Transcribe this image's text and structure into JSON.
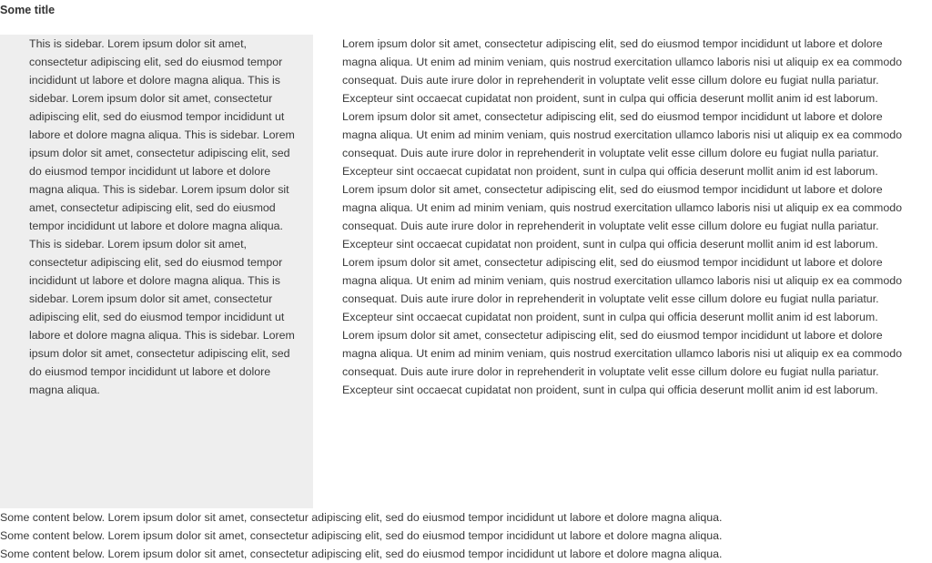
{
  "page": {
    "title": "Some title"
  },
  "sidebar": {
    "text": "This is sidebar. Lorem ipsum dolor sit amet, consectetur adipiscing elit, sed do eiusmod tempor incididunt ut labore et dolore magna aliqua. This is sidebar. Lorem ipsum dolor sit amet, consectetur adipiscing elit, sed do eiusmod tempor incididunt ut labore et dolore magna aliqua. This is sidebar. Lorem ipsum dolor sit amet, consectetur adipiscing elit, sed do eiusmod tempor incididunt ut labore et dolore magna aliqua. This is sidebar. Lorem ipsum dolor sit amet, consectetur adipiscing elit, sed do eiusmod tempor incididunt ut labore et dolore magna aliqua. This is sidebar. Lorem ipsum dolor sit amet, consectetur adipiscing elit, sed do eiusmod tempor incididunt ut labore et dolore magna aliqua. This is sidebar. Lorem ipsum dolor sit amet, consectetur adipiscing elit, sed do eiusmod tempor incididunt ut labore et dolore magna aliqua. This is sidebar. Lorem ipsum dolor sit amet, consectetur adipiscing elit, sed do eiusmod tempor incididunt ut labore et dolore magna aliqua."
  },
  "main": {
    "text": "Lorem ipsum dolor sit amet, consectetur adipiscing elit, sed do eiusmod tempor incididunt ut labore et dolore magna aliqua. Ut enim ad minim veniam, quis nostrud exercitation ullamco laboris nisi ut aliquip ex ea commodo consequat. Duis aute irure dolor in reprehenderit in voluptate velit esse cillum dolore eu fugiat nulla pariatur. Excepteur sint occaecat cupidatat non proident, sunt in culpa qui officia deserunt mollit anim id est laborum. Lorem ipsum dolor sit amet, consectetur adipiscing elit, sed do eiusmod tempor incididunt ut labore et dolore magna aliqua. Ut enim ad minim veniam, quis nostrud exercitation ullamco laboris nisi ut aliquip ex ea commodo consequat. Duis aute irure dolor in reprehenderit in voluptate velit esse cillum dolore eu fugiat nulla pariatur. Excepteur sint occaecat cupidatat non proident, sunt in culpa qui officia deserunt mollit anim id est laborum. Lorem ipsum dolor sit amet, consectetur adipiscing elit, sed do eiusmod tempor incididunt ut labore et dolore magna aliqua. Ut enim ad minim veniam, quis nostrud exercitation ullamco laboris nisi ut aliquip ex ea commodo consequat. Duis aute irure dolor in reprehenderit in voluptate velit esse cillum dolore eu fugiat nulla pariatur. Excepteur sint occaecat cupidatat non proident, sunt in culpa qui officia deserunt mollit anim id est laborum. Lorem ipsum dolor sit amet, consectetur adipiscing elit, sed do eiusmod tempor incididunt ut labore et dolore magna aliqua. Ut enim ad minim veniam, quis nostrud exercitation ullamco laboris nisi ut aliquip ex ea commodo consequat. Duis aute irure dolor in reprehenderit in voluptate velit esse cillum dolore eu fugiat nulla pariatur. Excepteur sint occaecat cupidatat non proident, sunt in culpa qui officia deserunt mollit anim id est laborum. Lorem ipsum dolor sit amet, consectetur adipiscing elit, sed do eiusmod tempor incididunt ut labore et dolore magna aliqua. Ut enim ad minim veniam, quis nostrud exercitation ullamco laboris nisi ut aliquip ex ea commodo consequat. Duis aute irure dolor in reprehenderit in voluptate velit esse cillum dolore eu fugiat nulla pariatur. Excepteur sint occaecat cupidatat non proident, sunt in culpa qui officia deserunt mollit anim id est laborum."
  },
  "footer": {
    "lines": [
      "Some content below. Lorem ipsum dolor sit amet, consectetur adipiscing elit, sed do eiusmod tempor incididunt ut labore et dolore magna aliqua.",
      "Some content below. Lorem ipsum dolor sit amet, consectetur adipiscing elit, sed do eiusmod tempor incididunt ut labore et dolore magna aliqua.",
      "Some content below. Lorem ipsum dolor sit amet, consectetur adipiscing elit, sed do eiusmod tempor incididunt ut labore et dolore magna aliqua."
    ]
  },
  "colors": {
    "sidebar_background": "#eeeeee",
    "text": "#3a3a3a",
    "page_background": "#ffffff"
  }
}
